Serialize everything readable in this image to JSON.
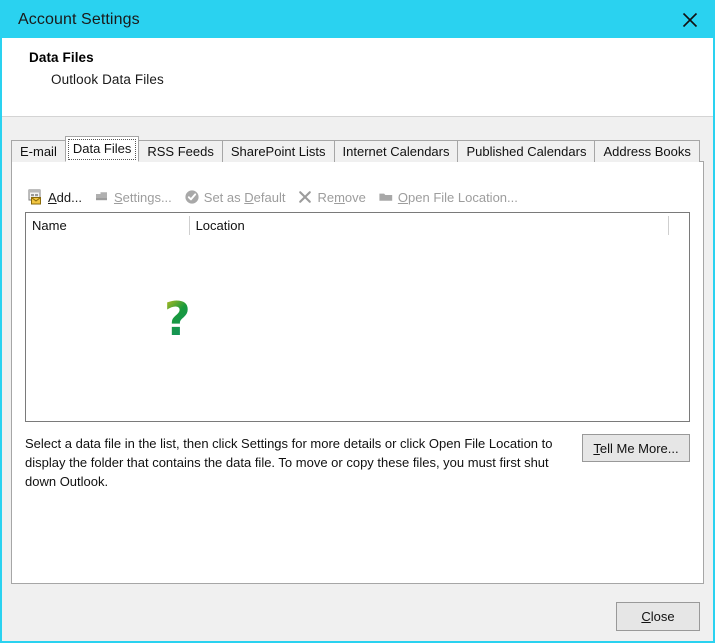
{
  "window": {
    "title": "Account Settings",
    "titlebar_color": "#2AD2F0",
    "close_icon": "close-x-icon"
  },
  "header": {
    "title": "Data Files",
    "subtitle": "Outlook Data Files"
  },
  "tabs": [
    {
      "label": "E-mail",
      "active": false
    },
    {
      "label": "Data Files",
      "active": true
    },
    {
      "label": "RSS Feeds",
      "active": false
    },
    {
      "label": "SharePoint Lists",
      "active": false
    },
    {
      "label": "Internet Calendars",
      "active": false
    },
    {
      "label": "Published Calendars",
      "active": false
    },
    {
      "label": "Address Books",
      "active": false
    }
  ],
  "toolbar": [
    {
      "id": "add",
      "label": "Add...",
      "accel": "A",
      "icon": "add-data-file-icon",
      "enabled": true
    },
    {
      "id": "settings",
      "label": "Settings...",
      "accel": "S",
      "icon": "settings-icon",
      "enabled": false
    },
    {
      "id": "set-as-default",
      "label": "Set as Default",
      "accel": "D",
      "icon": "check-circle-icon",
      "enabled": false
    },
    {
      "id": "remove",
      "label": "Remove",
      "accel": "m",
      "icon": "remove-x-icon",
      "enabled": false
    },
    {
      "id": "open-file-location",
      "label": "Open File Location...",
      "accel": "O",
      "icon": "folder-icon",
      "enabled": false
    }
  ],
  "list": {
    "columns": [
      "Name",
      "Location"
    ],
    "rows": [],
    "empty_glyph": "?"
  },
  "hint": {
    "text": "Select a data file in the list, then click Settings for more details or click Open File Location to display the folder that contains the data file. To move or copy these files, you must first shut down Outlook."
  },
  "buttons": {
    "tell_me_more": {
      "label": "Tell Me More...",
      "accel": "T"
    },
    "close": {
      "label": "Close",
      "accel": "C"
    }
  }
}
